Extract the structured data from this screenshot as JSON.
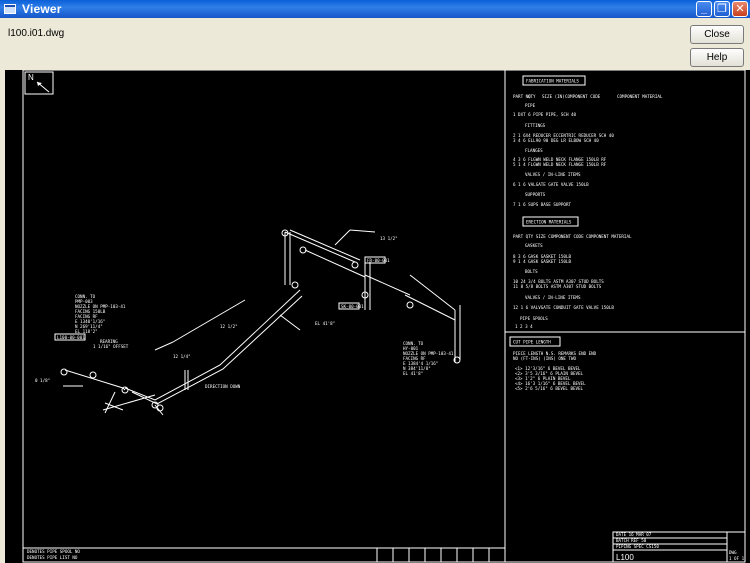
{
  "window": {
    "title": "Viewer",
    "filename": "l100.i01.dwg",
    "close_label": "Close",
    "help_label": "Help"
  },
  "drawing": {
    "sheet_id": "L100",
    "sheet_count": "1 OF 1",
    "north_label": "N",
    "fab_materials_title": "FABRICATION MATERIALS",
    "fab_headers": [
      "PART NO.",
      "QTY",
      "SIZE (IN)",
      "COMPONENT CODE",
      "COMPONENT MATERIAL"
    ],
    "fab_sections": [
      "PIPE",
      "FITTINGS",
      "FLANGES",
      "VALVES / IN-LINE ITEMS",
      "SUPPORTS"
    ],
    "erection_materials_title": "ERECTION MATERIALS",
    "erection_sections": [
      "GASKETS",
      "BOLTS",
      "VALVES / IN-LINE ITEMS"
    ],
    "pipe_spools_label": "PIPE SPOOLS",
    "pipe_spools_value": "1 2 3 4",
    "cut_pipe_title": "CUT PIPE LENGTH",
    "cut_pipe_headers": [
      "PIECE NO",
      "LENGTH (FT-INS)",
      "N.S. (INS)",
      "REMARKS",
      "END ONE",
      "END TWO"
    ],
    "direction_label": "DIRECTION DOWN",
    "spool_tags": [
      "L100-00-001",
      "FR-00-001",
      "SK-00-001"
    ]
  }
}
